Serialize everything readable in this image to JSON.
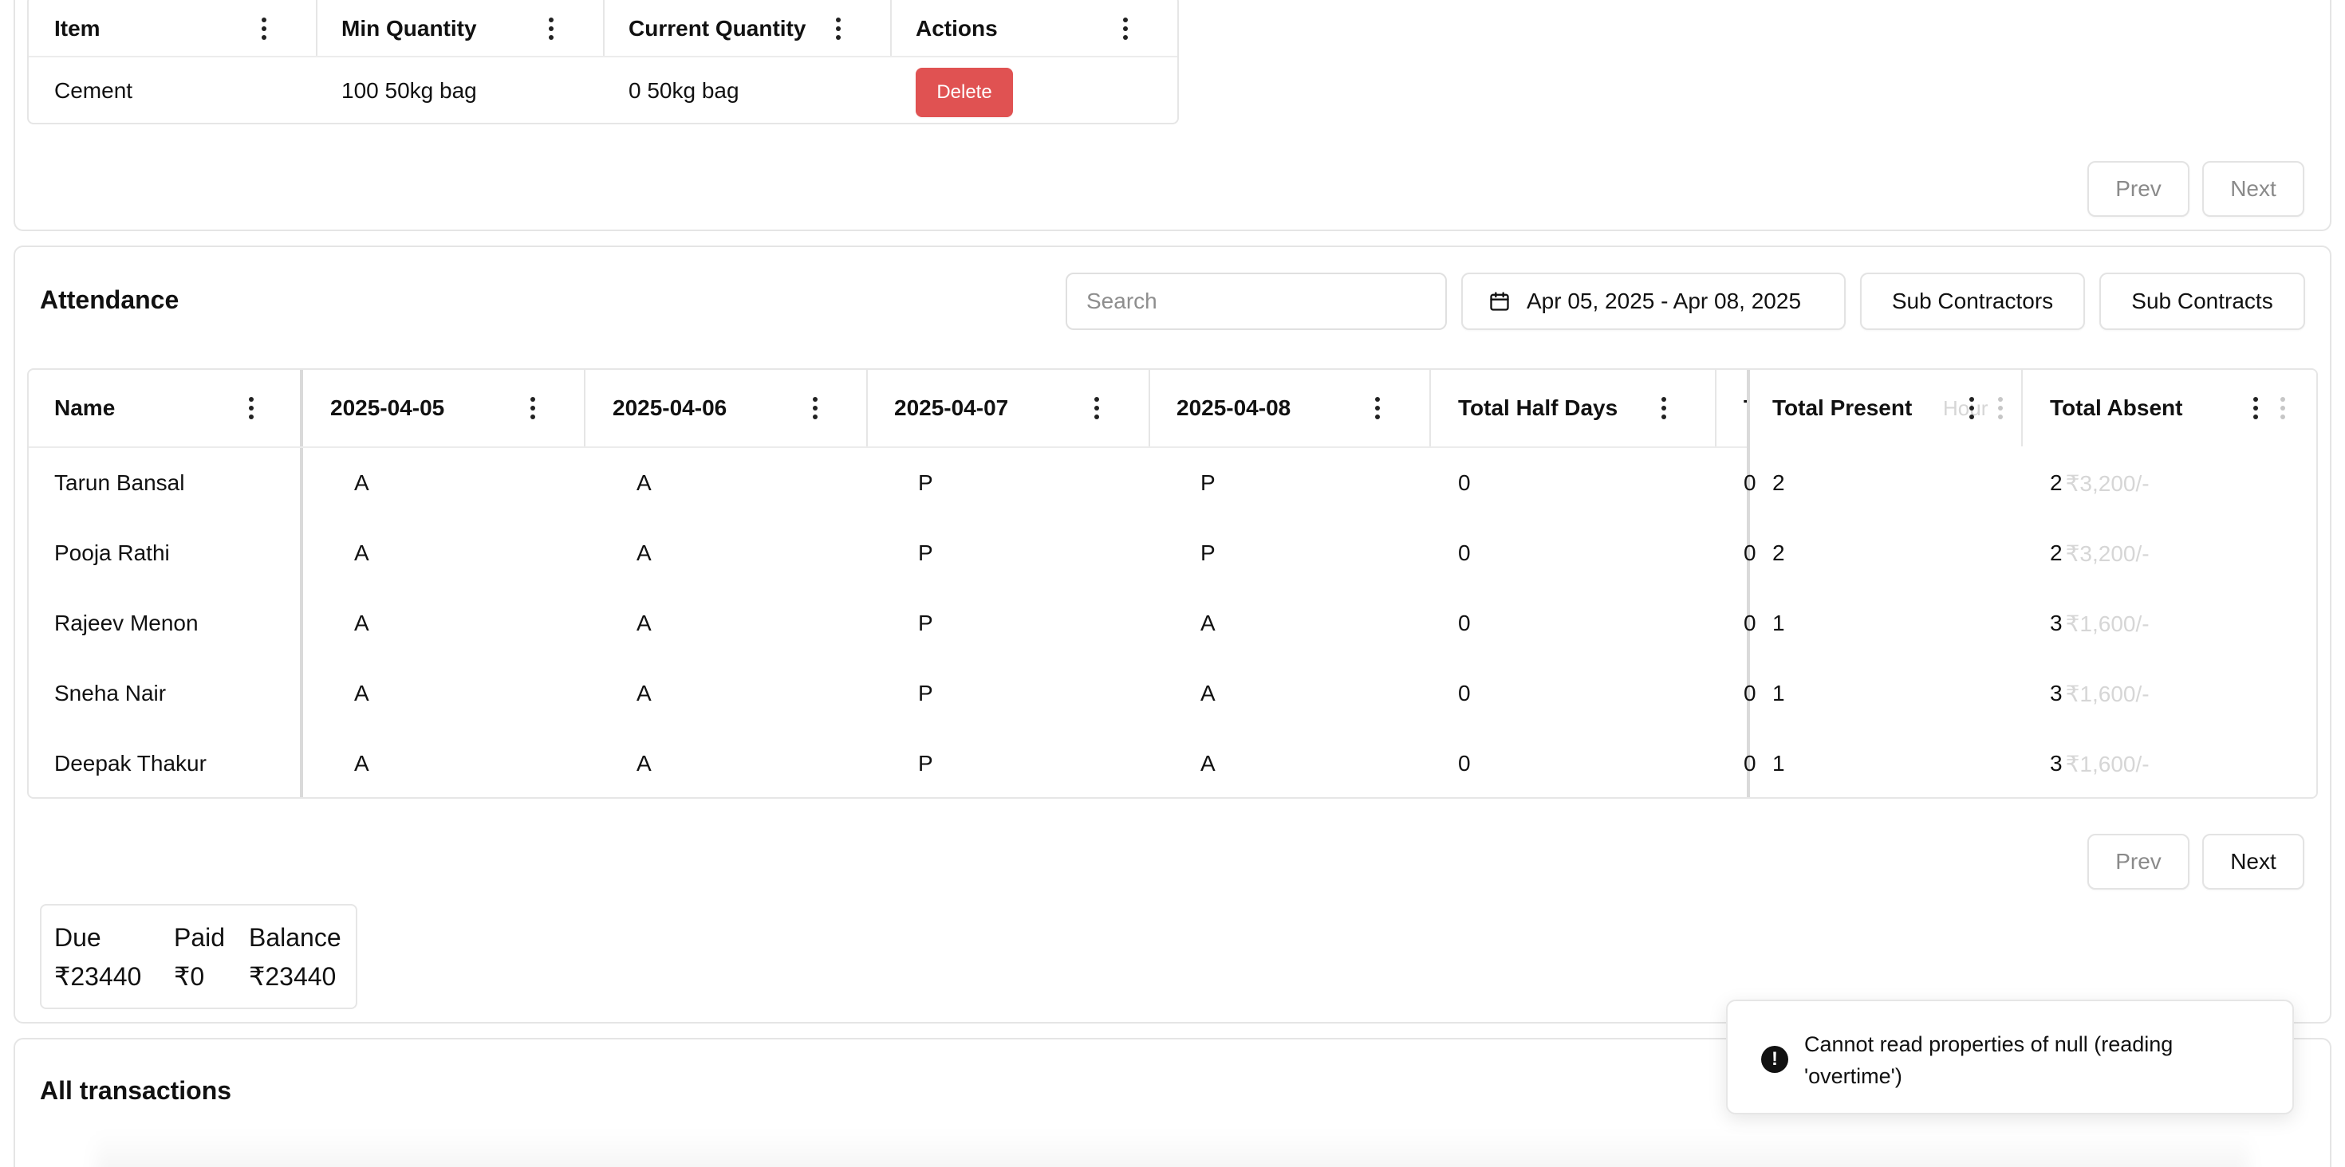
{
  "inventory": {
    "columns": [
      "Item",
      "Min Quantity",
      "Current Quantity",
      "Actions"
    ],
    "rows": [
      {
        "item": "Cement",
        "min_quantity": "100 50kg bag",
        "current_quantity": "0 50kg bag",
        "action_label": "Delete"
      }
    ],
    "prev_label": "Prev",
    "next_label": "Next"
  },
  "attendance": {
    "title": "Attendance",
    "search_placeholder": "Search",
    "date_range": "Apr 05, 2025 - Apr 08, 2025",
    "sub_contractors_label": "Sub Contractors",
    "sub_contracts_label": "Sub Contracts",
    "columns": [
      "Name",
      "2025-04-05",
      "2025-04-06",
      "2025-04-07",
      "2025-04-08",
      "Total Half Days",
      "Total Present",
      "Total Absent"
    ],
    "hidden_column_fragment": "T",
    "hidden_column_fragment_2": "Hour",
    "rows": [
      {
        "name": "Tarun Bansal",
        "d1": "A",
        "d2": "A",
        "d3": "P",
        "d4": "P",
        "half": "0",
        "hidden": "0",
        "present": "2",
        "absent": "2",
        "ghost_amount": "₹3,200/-"
      },
      {
        "name": "Pooja Rathi",
        "d1": "A",
        "d2": "A",
        "d3": "P",
        "d4": "P",
        "half": "0",
        "hidden": "0",
        "present": "2",
        "absent": "2",
        "ghost_amount": "₹3,200/-"
      },
      {
        "name": "Rajeev Menon",
        "d1": "A",
        "d2": "A",
        "d3": "P",
        "d4": "A",
        "half": "0",
        "hidden": "0",
        "present": "1",
        "absent": "3",
        "ghost_amount": "₹1,600/-"
      },
      {
        "name": "Sneha Nair",
        "d1": "A",
        "d2": "A",
        "d3": "P",
        "d4": "A",
        "half": "0",
        "hidden": "0",
        "present": "1",
        "absent": "3",
        "ghost_amount": "₹1,600/-"
      },
      {
        "name": "Deepak Thakur",
        "d1": "A",
        "d2": "A",
        "d3": "P",
        "d4": "A",
        "half": "0",
        "hidden": "0",
        "present": "1",
        "absent": "3",
        "ghost_amount": "₹1,600/-"
      }
    ],
    "prev_label": "Prev",
    "next_label": "Next",
    "summary": {
      "due_label": "Due",
      "paid_label": "Paid",
      "balance_label": "Balance",
      "due_value": "₹23440",
      "paid_value": "₹0",
      "balance_value": "₹23440"
    }
  },
  "transactions": {
    "title": "All transactions"
  },
  "toast": {
    "message": "Cannot read properties of null (reading 'overtime')"
  },
  "icons": {
    "column_menu": "kebab-vertical-icon",
    "calendar": "calendar-icon",
    "error": "alert-circle-icon"
  },
  "colors": {
    "danger": "#e05252",
    "border": "#e6e6e6"
  }
}
